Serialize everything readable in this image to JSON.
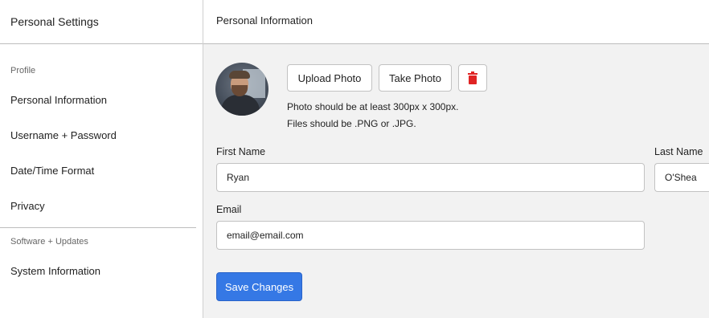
{
  "sidebar": {
    "title": "Personal Settings",
    "sections": [
      {
        "label": "Profile"
      },
      {
        "label": "Software + Updates"
      }
    ],
    "items": [
      {
        "label": "Personal Information"
      },
      {
        "label": "Username + Password"
      },
      {
        "label": "Date/Time Format"
      },
      {
        "label": "Privacy"
      },
      {
        "label": "System Information"
      }
    ]
  },
  "main": {
    "title": "Personal Information",
    "photo": {
      "upload_label": "Upload Photo",
      "take_label": "Take Photo",
      "delete_icon": "trash-icon",
      "hint_line1": "Photo should be at least 300px x 300px.",
      "hint_line2": "Files should be .PNG or .JPG."
    },
    "form": {
      "first_name_label": "First Name",
      "first_name_value": "Ryan",
      "last_name_label": "Last Name",
      "last_name_value": "O'Shea",
      "email_label": "Email",
      "email_value": "email@email.com"
    },
    "save_label": "Save Changes"
  },
  "colors": {
    "accent": "#3578e5",
    "danger": "#e02424",
    "panel_bg": "#f2f2f2"
  }
}
